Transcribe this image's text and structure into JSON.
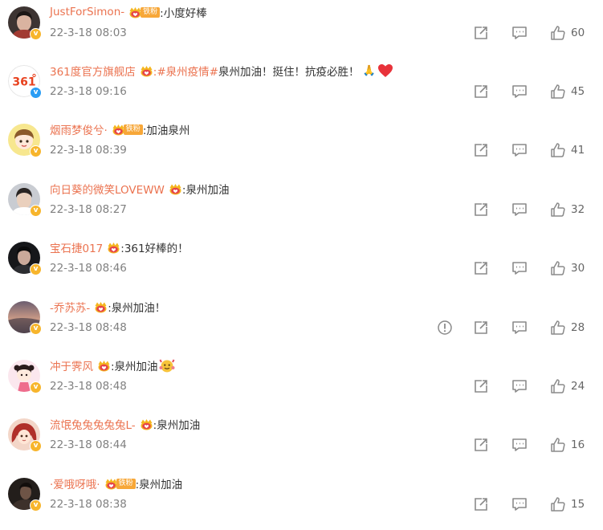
{
  "comments": [
    {
      "user": "JustForSimon-",
      "badge": "gold",
      "fan_badge": "铁粉",
      "topic": "",
      "text": ":小度好棒",
      "extras": [],
      "time": "22-3-18 08:03",
      "likes": "60",
      "report": false,
      "avatar_kind": "man-dark"
    },
    {
      "user": "361度官方旗舰店",
      "badge": "blue",
      "fan_badge": "",
      "topic": ":#泉州疫情#",
      "text": " 泉州加油！挺住！抗疫必胜！",
      "extras": [
        "hands",
        "heart"
      ],
      "time": "22-3-18 09:16",
      "likes": "45",
      "report": false,
      "avatar_kind": "logo-361"
    },
    {
      "user": "烟雨梦俊兮·",
      "badge": "gold",
      "fan_badge": "铁粉",
      "topic": "",
      "text": ":加油泉州",
      "extras": [],
      "time": "22-3-18 08:39",
      "likes": "41",
      "report": false,
      "avatar_kind": "cartoon-yellow"
    },
    {
      "user": "向日葵的微笑LOVEWW",
      "badge": "gold",
      "fan_badge": "",
      "topic": "",
      "text": ":泉州加油",
      "extras": [],
      "time": "22-3-18 08:27",
      "likes": "32",
      "report": false,
      "avatar_kind": "man-light"
    },
    {
      "user": "宝石捷017",
      "badge": "gold",
      "fan_badge": "",
      "topic": "",
      "text": ":361好棒的！",
      "extras": [],
      "time": "22-3-18 08:46",
      "likes": "30",
      "report": false,
      "avatar_kind": "man-black"
    },
    {
      "user": "-乔苏苏-",
      "badge": "gold",
      "fan_badge": "",
      "topic": "",
      "text": ":泉州加油！",
      "extras": [],
      "time": "22-3-18 08:48",
      "likes": "28",
      "report": true,
      "avatar_kind": "sunset"
    },
    {
      "user": "冲于霁风",
      "badge": "gold",
      "fan_badge": "",
      "topic": "",
      "text": ":泉州加油",
      "extras": [
        "flex"
      ],
      "time": "22-3-18 08:48",
      "likes": "24",
      "report": false,
      "avatar_kind": "cartoon-pink"
    },
    {
      "user": "流氓兔兔兔兔兔L-",
      "badge": "gold",
      "fan_badge": "",
      "topic": "",
      "text": ":泉州加油",
      "extras": [],
      "time": "22-3-18 08:44",
      "likes": "16",
      "report": false,
      "avatar_kind": "cartoon-red"
    },
    {
      "user": "·爱哦呀哦·",
      "badge": "gold",
      "fan_badge": "铁粉",
      "topic": "",
      "text": ":泉州加油",
      "extras": [],
      "time": "22-3-18 08:38",
      "likes": "15",
      "report": false,
      "avatar_kind": "dark-photo"
    }
  ],
  "colors": {
    "username": "#eb7350",
    "timestamp": "#808080",
    "badge_gold": "#f7b52c",
    "badge_blue": "#2a9df4",
    "fan_badge": "#f7a738",
    "icon": "#8a8a8a"
  },
  "icons": {
    "share": "share-icon",
    "comment": "comment-icon",
    "like": "like-icon",
    "report": "report-icon",
    "crown": "crown-icon",
    "verified": "verified-icon"
  }
}
